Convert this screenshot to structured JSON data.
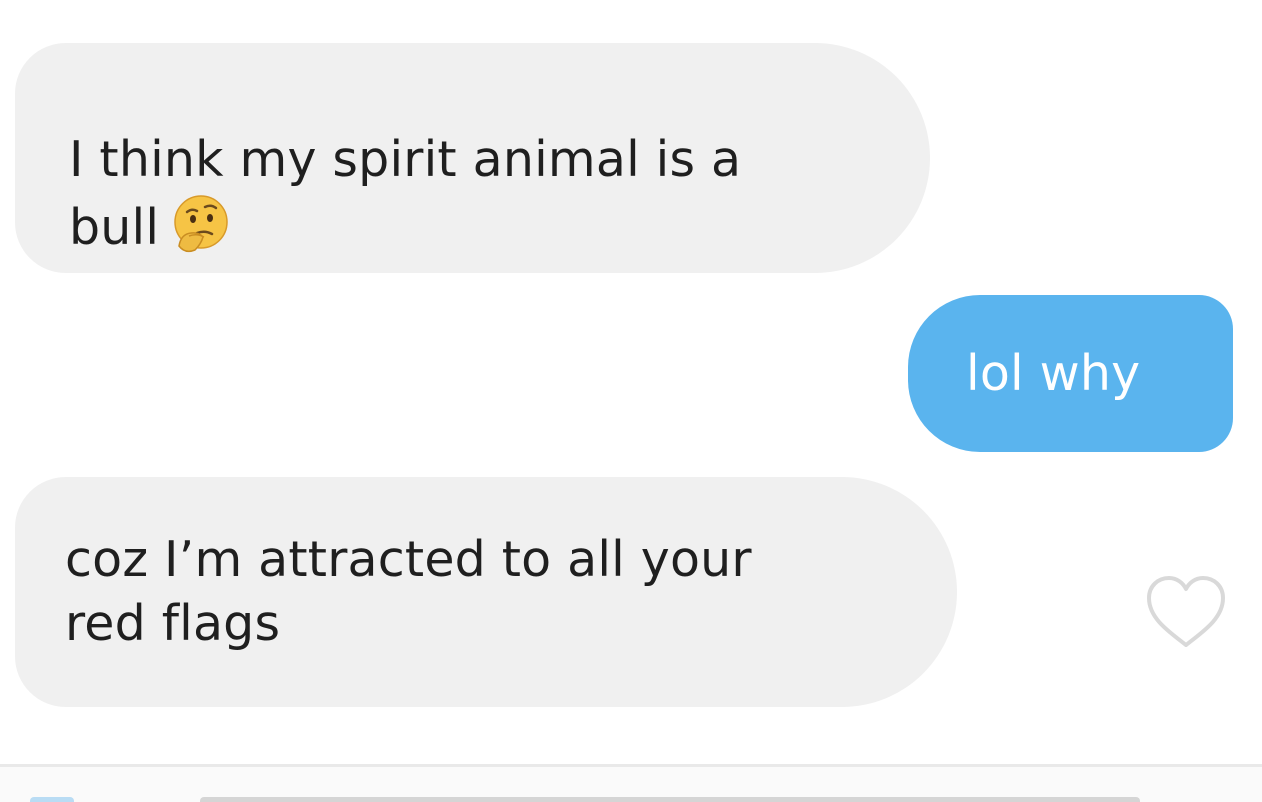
{
  "messages": [
    {
      "direction": "incoming",
      "text_line1": "I think my spirit animal is a",
      "text_line2": "bull",
      "emoji": "thinking-face-icon"
    },
    {
      "direction": "outgoing",
      "text": "lol why"
    },
    {
      "direction": "incoming",
      "text_line1": "coz I’m attracted to all your",
      "text_line2": "red flags"
    }
  ],
  "actions": {
    "like_icon": "heart-outline-icon"
  },
  "colors": {
    "incoming_bubble": "#f0f0f0",
    "outgoing_bubble": "#5ab4ee",
    "incoming_text": "#1f1f1f",
    "outgoing_text": "#ffffff"
  }
}
